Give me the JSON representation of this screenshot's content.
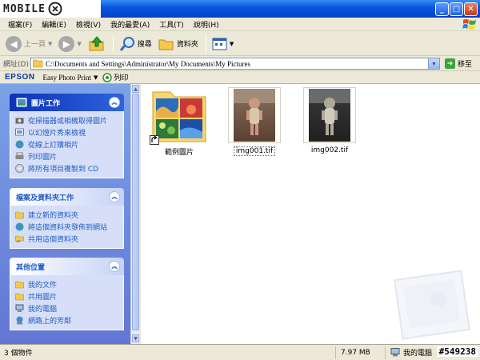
{
  "brand": {
    "text": "MOBILE"
  },
  "title_buttons": {
    "minimize": "_",
    "maximize": "□",
    "close": "✕"
  },
  "menu": [
    "檔案(F)",
    "編輯(E)",
    "檢視(V)",
    "我的最愛(A)",
    "工具(T)",
    "說明(H)"
  ],
  "toolbar": {
    "back_label": "上一頁",
    "search_label": "搜尋",
    "folders_label": "資料夾"
  },
  "address": {
    "label": "網址(D)",
    "value": "C:\\Documents and Settings\\Administrator\\My Documents\\My Pictures",
    "go_label": "移至"
  },
  "epson": {
    "brand": "EPSON",
    "product": "Easy Photo Print",
    "print_label": "列印"
  },
  "sidebar": {
    "picture_tasks": {
      "title": "圖片工作",
      "items": [
        "從掃描器或相機取得圖片",
        "以幻燈片秀來檢視",
        "從線上訂購相片",
        "列印圖片",
        "將所有項目複製到 CD"
      ]
    },
    "file_tasks": {
      "title": "檔案及資料夾工作",
      "items": [
        "建立新的資料夾",
        "將這個資料夾發佈到網站",
        "共用這個資料夾"
      ]
    },
    "other_places": {
      "title": "其他位置",
      "items": [
        "我的文件",
        "共用圖片",
        "我的電腦",
        "網路上的芳鄰"
      ]
    }
  },
  "files": [
    {
      "name": "範例圖片",
      "type": "folder"
    },
    {
      "name": "img001.tif",
      "type": "image"
    },
    {
      "name": "img002.tif",
      "type": "image"
    }
  ],
  "status": {
    "count": "3 個物件",
    "size": "7.97 MB",
    "location": "我的電腦"
  },
  "stamp": "#549238",
  "colors": {
    "title_blue": "#0a58e0",
    "task_link": "#215dc6",
    "sidebar_bg": "#7ba2e7"
  }
}
